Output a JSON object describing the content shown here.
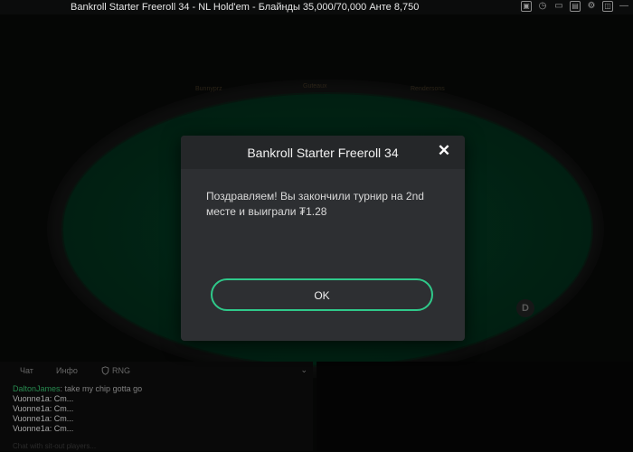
{
  "window": {
    "title": "Bankroll Starter Freeroll 34 - NL Hold'em - Блайнды 35,000/70,000 Анте 8,750"
  },
  "titlebar_icons": [
    "window-icon",
    "clock-icon",
    "folder-icon",
    "layout-icon",
    "settings-icon",
    "user-icon",
    "minimize-icon"
  ],
  "table": {
    "seat_labels": [
      "Bunnyprz",
      "Guteaux",
      "Rendersons"
    ],
    "dealer_button": "D"
  },
  "dialog": {
    "title": "Bankroll Starter Freeroll 34",
    "message": "Поздравляем! Вы закончили турнир на 2nd месте и выиграли ₮1.28",
    "ok_label": "OK"
  },
  "chat": {
    "tabs": [
      "Чат",
      "Инфо",
      "RNG"
    ],
    "lines": [
      {
        "name": "DaltonJames",
        "text": "take my chip gotta go",
        "style": "normal"
      },
      {
        "text": "Vuonne1a: Cm... ",
        "style": "red"
      },
      {
        "text": "Vuonne1a: Cm... ",
        "style": "red"
      },
      {
        "text": "Vuonne1a: Cm... ",
        "style": "red"
      },
      {
        "text": "Vuonne1a: Cm... ",
        "style": "red"
      }
    ],
    "bottom_text": "Chat with sit-out players..."
  },
  "colors": {
    "accent": "#2fc98a",
    "felt": "#033a22",
    "dialog_bg": "#2d2f32"
  }
}
